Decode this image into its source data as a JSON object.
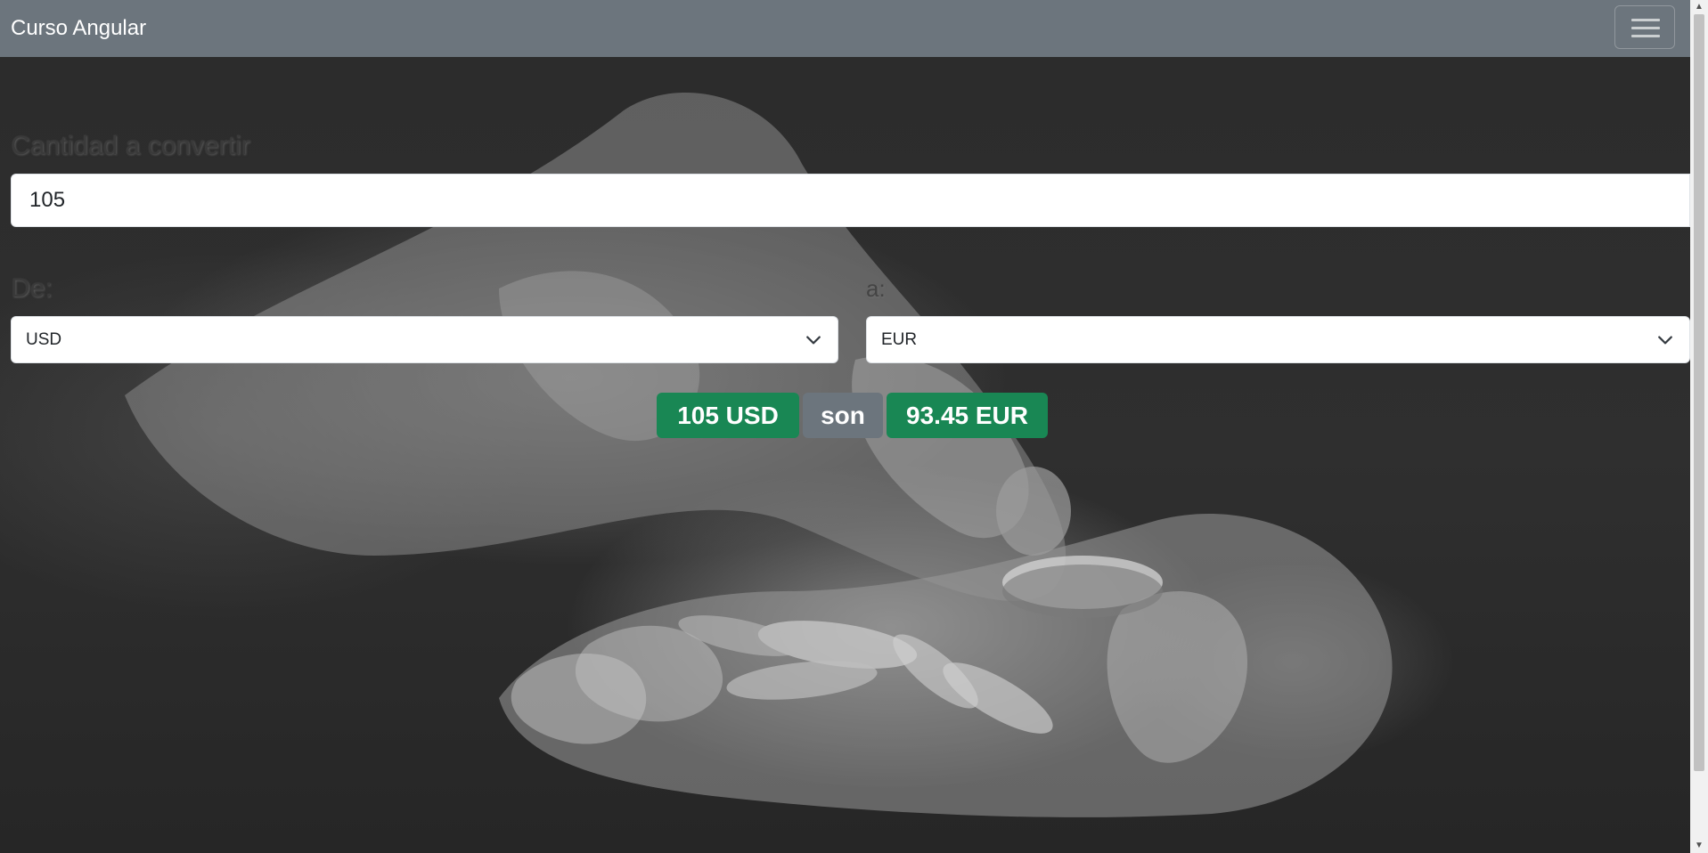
{
  "navbar": {
    "brand": "Curso Angular",
    "menu_icon": "hamburger-menu-icon"
  },
  "form": {
    "amount_label": "Cantidad a convertir",
    "amount_value": "105",
    "from_label": "De:",
    "from_selected": "USD",
    "to_label": "a:",
    "to_selected": "EUR"
  },
  "result": {
    "from_text": "105 USD",
    "connector": "son",
    "to_text": "93.45 EUR"
  },
  "colors": {
    "navbar": "#6c757d",
    "success": "#198754",
    "secondary": "#6c757d"
  }
}
